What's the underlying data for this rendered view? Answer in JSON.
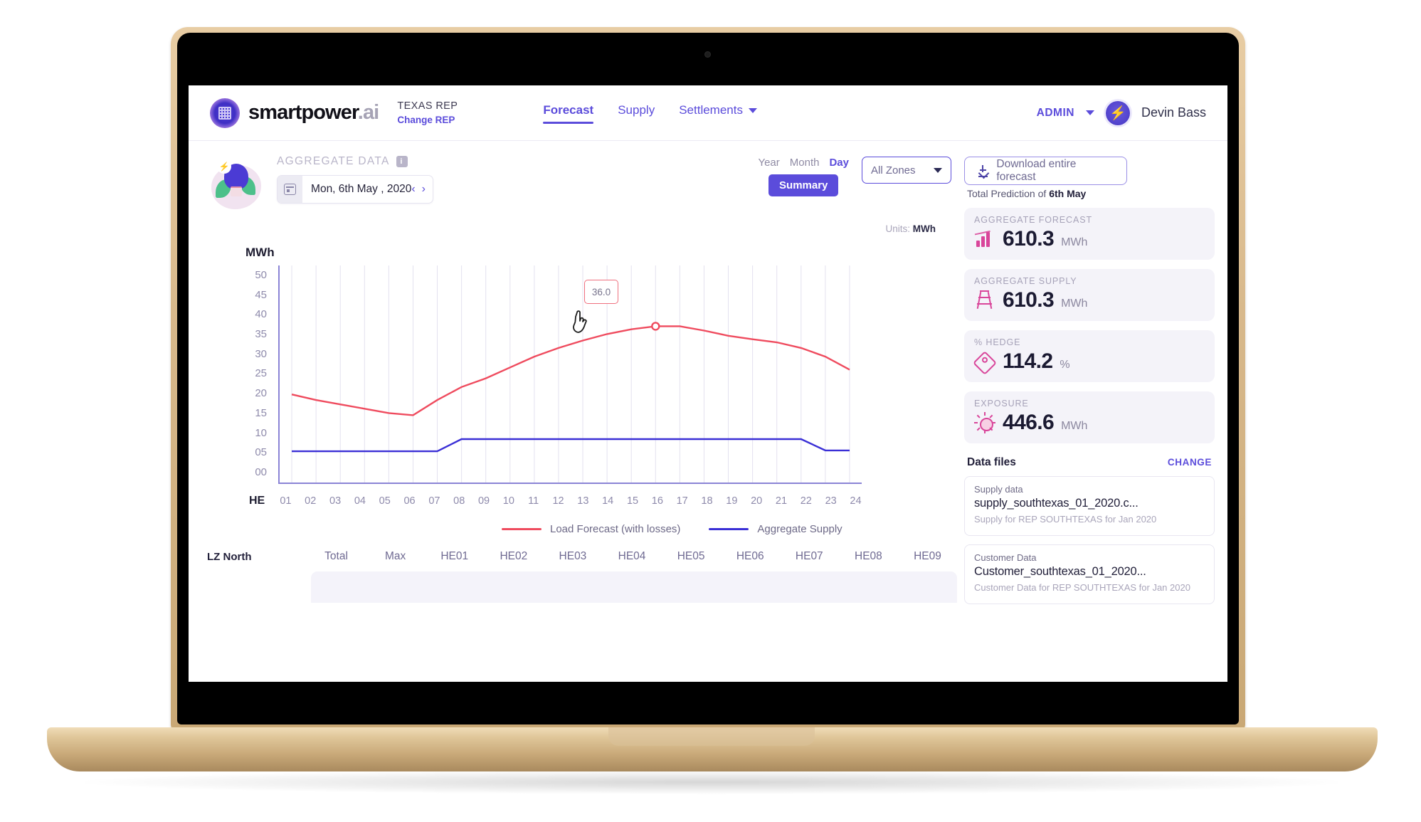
{
  "header": {
    "brand_main": "smartpower",
    "brand_suffix": ".ai",
    "rep_name": "TEXAS REP",
    "rep_change": "Change REP",
    "nav": [
      {
        "label": "Forecast",
        "active": true,
        "has_caret": false
      },
      {
        "label": "Supply",
        "active": false,
        "has_caret": false
      },
      {
        "label": "Settlements",
        "active": false,
        "has_caret": true
      }
    ],
    "admin_label": "ADMIN",
    "user_name": "Devin Bass"
  },
  "controls": {
    "aggregate_title": "AGGREGATE DATA",
    "info_badge": "i",
    "date_value": "Mon, 6th May , 2020",
    "prev_arrow": "‹",
    "next_arrow": "›",
    "periods": [
      {
        "label": "Year",
        "active": false
      },
      {
        "label": "Month",
        "active": false
      },
      {
        "label": "Day",
        "active": true
      }
    ],
    "summary_label": "Summary",
    "zone_label": "All Zones",
    "download_label": "Download entire forecast",
    "units_prefix": "Units:",
    "units_value": "MWh"
  },
  "chart_data": {
    "type": "line",
    "title": "",
    "xlabel": "HE",
    "ylabel": "MWh",
    "ylim": [
      0,
      50
    ],
    "yticks": [
      "50",
      "45",
      "40",
      "35",
      "30",
      "25",
      "20",
      "15",
      "10",
      "05",
      "00"
    ],
    "categories": [
      "01",
      "02",
      "03",
      "04",
      "05",
      "06",
      "07",
      "08",
      "09",
      "10",
      "11",
      "12",
      "13",
      "14",
      "15",
      "16",
      "17",
      "18",
      "19",
      "20",
      "21",
      "22",
      "23",
      "24"
    ],
    "grid": true,
    "legend_position": "bottom",
    "series": [
      {
        "name": "Load Forecast (with losses)",
        "color": "#ef4b5e",
        "values": [
          20.3,
          19.0,
          18.0,
          17.0,
          16.0,
          15.5,
          19.0,
          22.0,
          24.0,
          26.5,
          29.0,
          31.0,
          32.7,
          34.2,
          35.3,
          36.0,
          36.0,
          35.0,
          33.8,
          33.0,
          32.3,
          31.0,
          29.0,
          26.0
        ]
      },
      {
        "name": "Aggregate Supply",
        "color": "#3a2fd6",
        "values": [
          7.2,
          7.2,
          7.2,
          7.2,
          7.2,
          7.2,
          7.2,
          10.0,
          10.0,
          10.0,
          10.0,
          10.0,
          10.0,
          10.0,
          10.0,
          10.0,
          10.0,
          10.0,
          10.0,
          10.0,
          10.0,
          10.0,
          7.4,
          7.4
        ]
      }
    ],
    "tooltip": {
      "value": "36.0",
      "at_category": "16"
    }
  },
  "summary_panel": {
    "total_prediction_prefix": "Total Prediction of",
    "total_prediction_date": "6th May",
    "metrics": [
      {
        "label": "AGGREGATE FORECAST",
        "value": "610.3",
        "unit": "MWh",
        "icon": "bar-chart-icon"
      },
      {
        "label": "AGGREGATE SUPPLY",
        "value": "610.3",
        "unit": "MWh",
        "icon": "transmission-tower-icon"
      },
      {
        "label": "% HEDGE",
        "value": "114.2",
        "unit": "%",
        "icon": "price-tag-icon"
      },
      {
        "label": "EXPOSURE",
        "value": "446.6",
        "unit": "MWh",
        "icon": "sun-icon"
      }
    ],
    "files_title": "Data files",
    "files_change": "CHANGE",
    "files": [
      {
        "kind": "Supply data",
        "name": "supply_southtexas_01_2020.c...",
        "desc": "Supply for REP SOUTHTEXAS for Jan 2020"
      },
      {
        "kind": "Customer Data",
        "name": "Customer_southtexas_01_2020...",
        "desc": "Customer Data for REP SOUTHTEXAS for Jan 2020"
      }
    ]
  },
  "table_peek": {
    "zone_label": "LZ North",
    "columns": [
      "Total",
      "Max",
      "HE01",
      "HE02",
      "HE03",
      "HE04",
      "HE05",
      "HE06",
      "HE07",
      "HE08",
      "HE09"
    ]
  },
  "colors": {
    "accent": "#5b4cdb",
    "forecast_line": "#ef4b5e",
    "supply_line": "#3a2fd6",
    "metric_icon": "#d9459a"
  }
}
